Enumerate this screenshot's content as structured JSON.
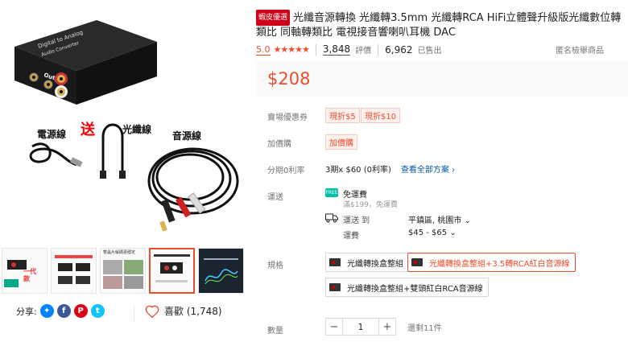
{
  "gallery": {
    "main_labels": {
      "power": "電源線",
      "gift": "送",
      "fiber": "光纖線",
      "audio": "音源線"
    },
    "thumb_texts": {
      "t1_label": "一代款",
      "t2_caption": "雙晶片解碼更穩定"
    }
  },
  "share": {
    "label": "分享:",
    "icons": [
      "messenger-icon",
      "facebook-icon",
      "pinterest-icon",
      "twitter-icon"
    ]
  },
  "like": {
    "label": "喜歡 (1,748)"
  },
  "product": {
    "mall_badge": "蝦皮優選",
    "title": "光纖音源轉換 光纖轉3.5mm 光纖轉RCA HiFi立體聲升級版光纖數位轉類比 同軸轉類比 電視接音響喇叭耳機 DAC",
    "rating": "5.0",
    "stars": "★★★★★",
    "review_count": "3,848",
    "review_label": "評價",
    "sold_count": "6,962",
    "sold_label": "已售出",
    "report": "匿名檢舉商品",
    "price": "$208"
  },
  "details": {
    "voucher_label": "賣場優惠券",
    "vouchers": [
      "現折$5",
      "現折$10"
    ],
    "addon_label": "加價購",
    "addon_tag": "加價購",
    "installment_label": "分期0利率",
    "installment_text": "3期x $60 (0利率)",
    "installment_link": "查看全部方案 ›",
    "shipping_label": "運送",
    "free_ship": "免運費",
    "free_ship_sub": "滿$199，免運費",
    "ship_to": "運送 到",
    "ship_location": "平鎮區, 桃園市 ⌄",
    "fee_label": "運費",
    "fee_value": "$45 - $65 ⌄",
    "spec_label": "規格",
    "variants": [
      "光纖轉換盒整組",
      "光纖轉換盒整組+3.5轉RCA紅白音源線",
      "光纖轉換盒整組+雙頭紅白RCA音源線"
    ],
    "qty_label": "數量",
    "qty_value": "1",
    "minus": "−",
    "plus": "+",
    "stock": "還剩11件"
  },
  "colors": {
    "accent": "#ee4d2d",
    "mall": "#d0011b",
    "free_ship": "#00bfa5",
    "link": "#0055aa"
  }
}
